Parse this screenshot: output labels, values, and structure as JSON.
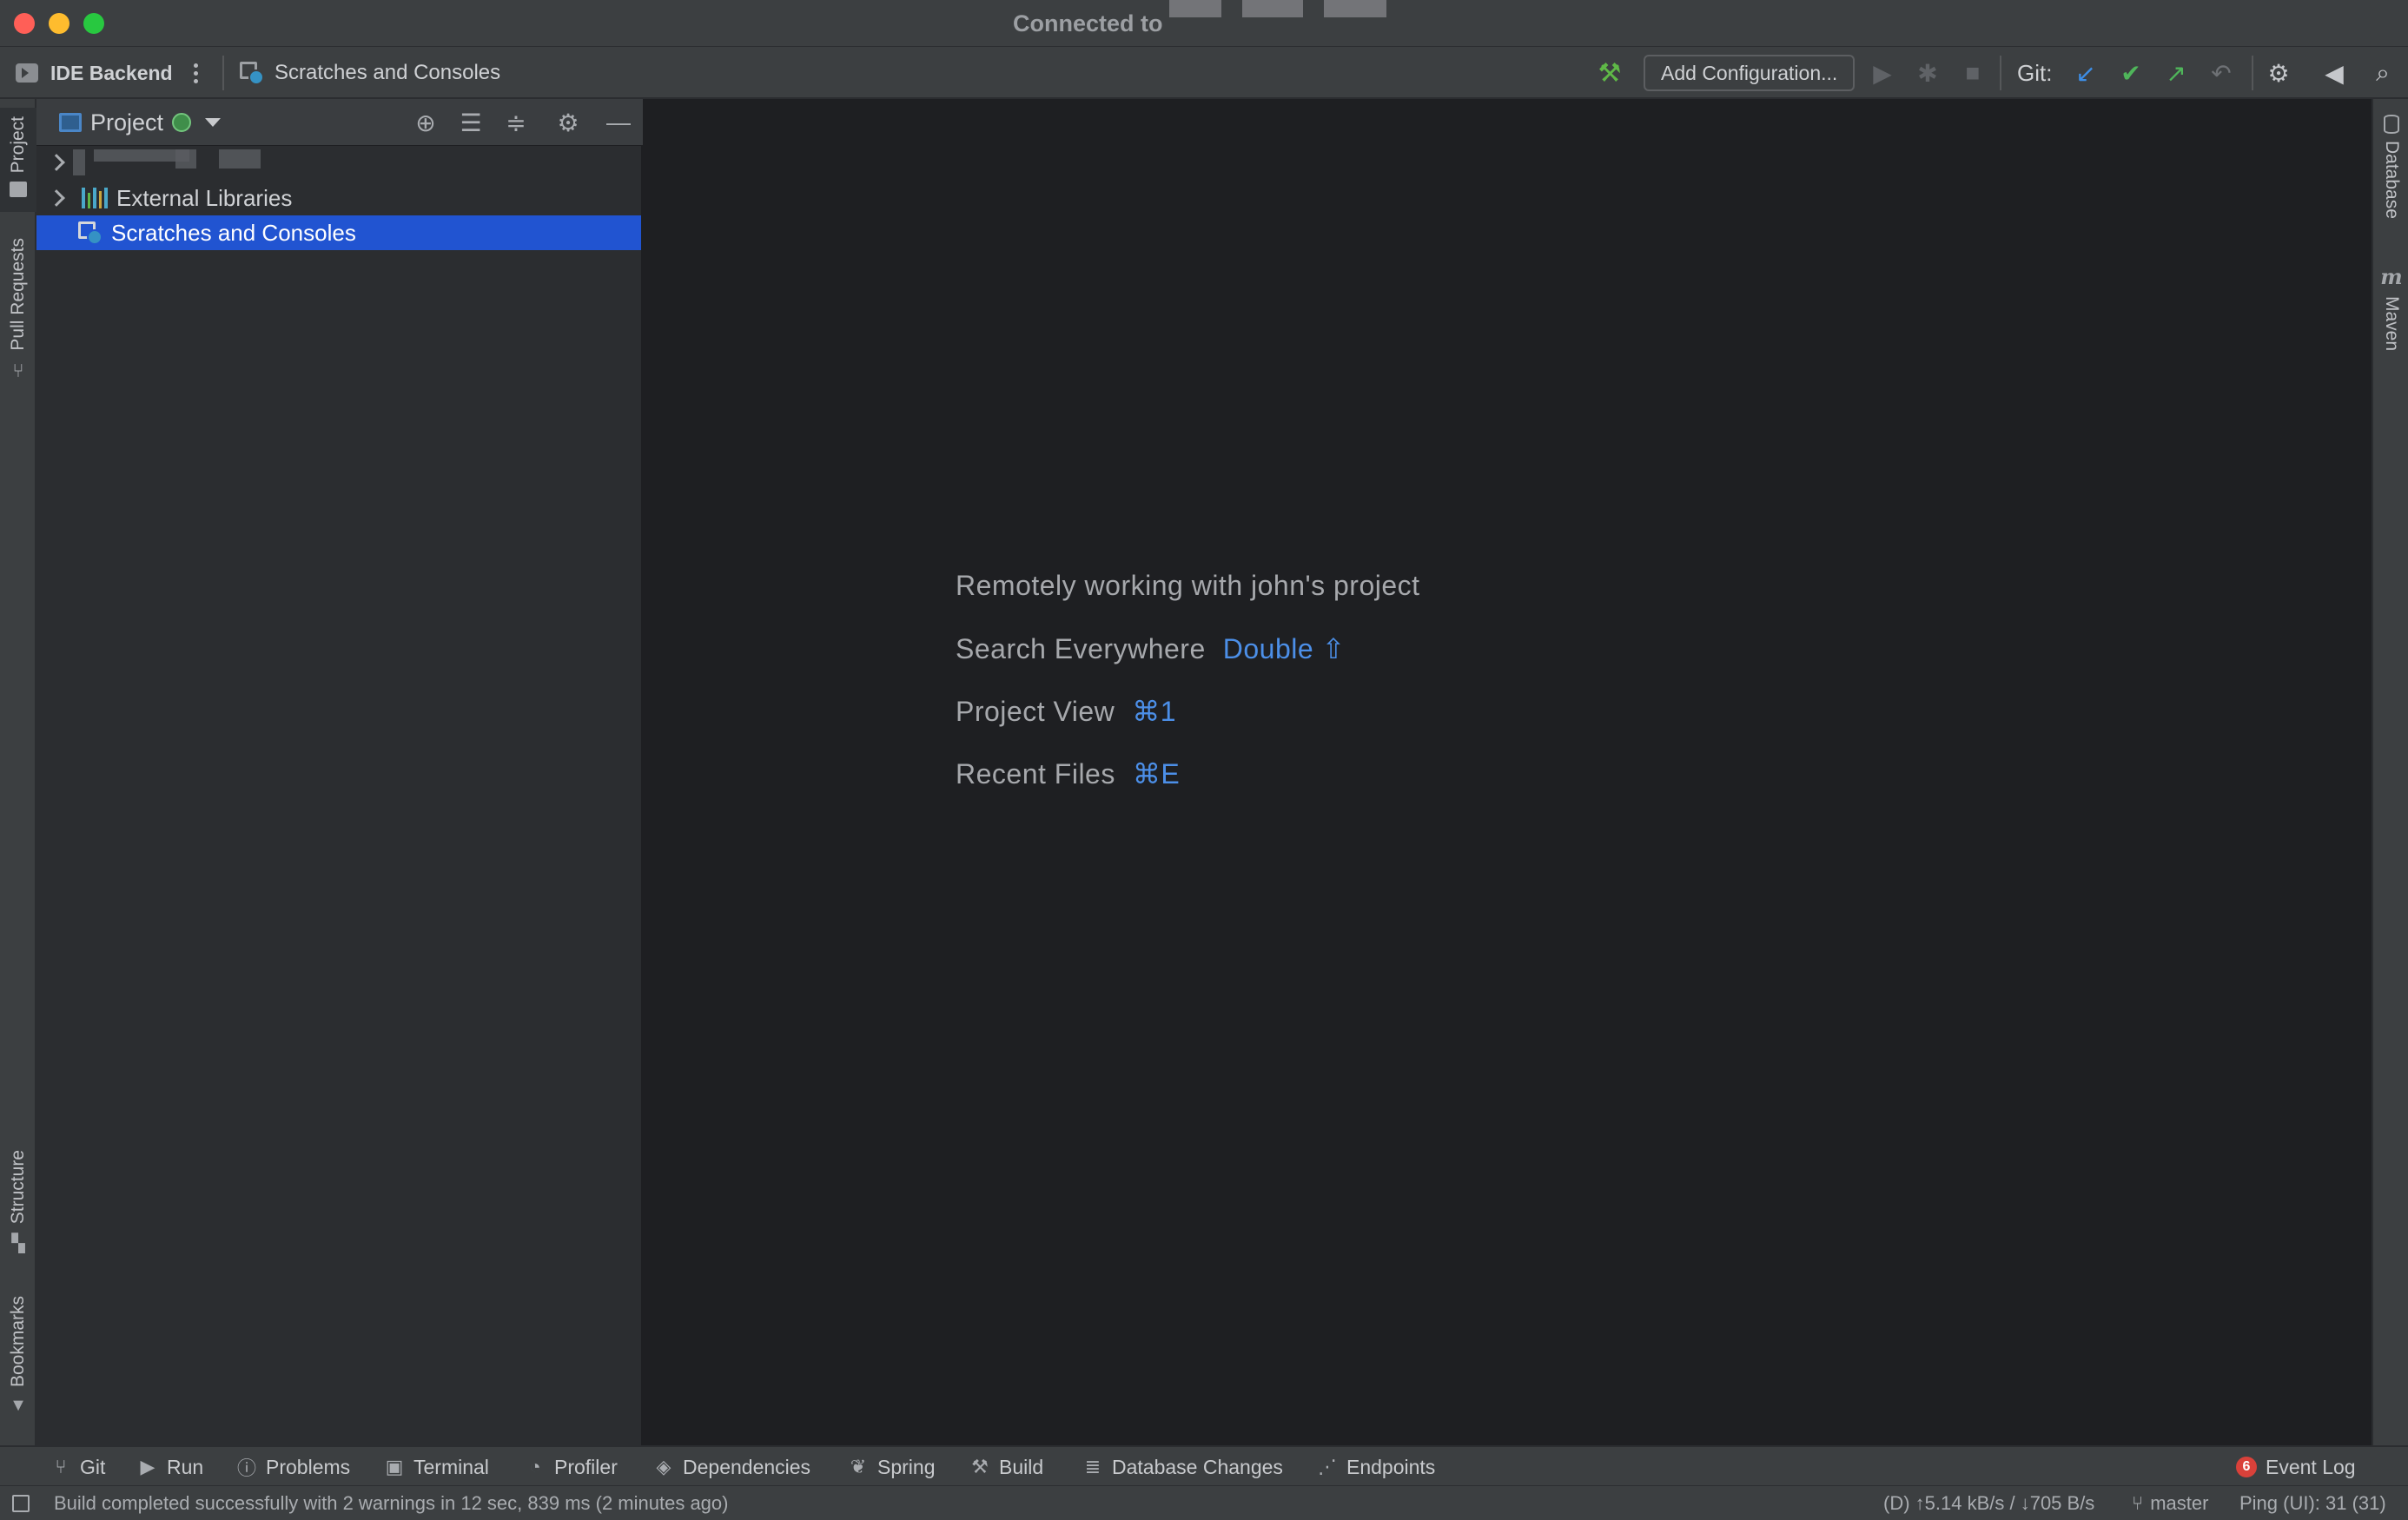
{
  "window": {
    "title": "Connected to"
  },
  "toolbar": {
    "backend_label": "IDE Backend",
    "breadcrumb": "Scratches and Consoles",
    "add_configuration": "Add Configuration...",
    "git_label": "Git:",
    "icons": [
      "build-hammer-icon",
      "run-icon",
      "debug-icon",
      "stop-icon",
      "git-update-icon",
      "git-commit-icon",
      "git-push-icon",
      "git-rollback-icon",
      "settings-icon",
      "code-with-me-icon",
      "search-icon"
    ]
  },
  "left_stripe": {
    "tabs": [
      "Project",
      "Pull Requests",
      "Structure",
      "Bookmarks"
    ]
  },
  "right_stripe": {
    "tabs": [
      "Database",
      "Maven"
    ]
  },
  "project_panel": {
    "title": "Project",
    "tree": [
      {
        "label": "External Libraries",
        "expandable": true
      },
      {
        "label": "Scratches and Consoles",
        "expandable": false,
        "selected": true
      }
    ]
  },
  "editor": {
    "hints": [
      {
        "text": "Remotely working with john's project",
        "shortcut": ""
      },
      {
        "text": "Search Everywhere",
        "shortcut": "Double ⇧"
      },
      {
        "text": "Project View",
        "shortcut": "⌘1"
      },
      {
        "text": "Recent Files",
        "shortcut": "⌘E"
      }
    ]
  },
  "bottom_tools": {
    "git": "Git",
    "run": "Run",
    "problems": "Problems",
    "terminal": "Terminal",
    "profiler": "Profiler",
    "dependencies": "Dependencies",
    "spring": "Spring",
    "build": "Build",
    "database_changes": "Database Changes",
    "endpoints": "Endpoints",
    "event_log": "Event Log",
    "event_count": "6"
  },
  "status": {
    "message": "Build completed successfully with 2 warnings in 12 sec, 839 ms (2 minutes ago)",
    "network": "(D) ↑5.14 kB/s / ↓705 B/s",
    "branch": "master",
    "ping": "Ping (UI): 31 (31)"
  },
  "colors": {
    "selection": "#2154d1",
    "accent_blue": "#4c8fe8",
    "git_green": "#4fb55a"
  }
}
